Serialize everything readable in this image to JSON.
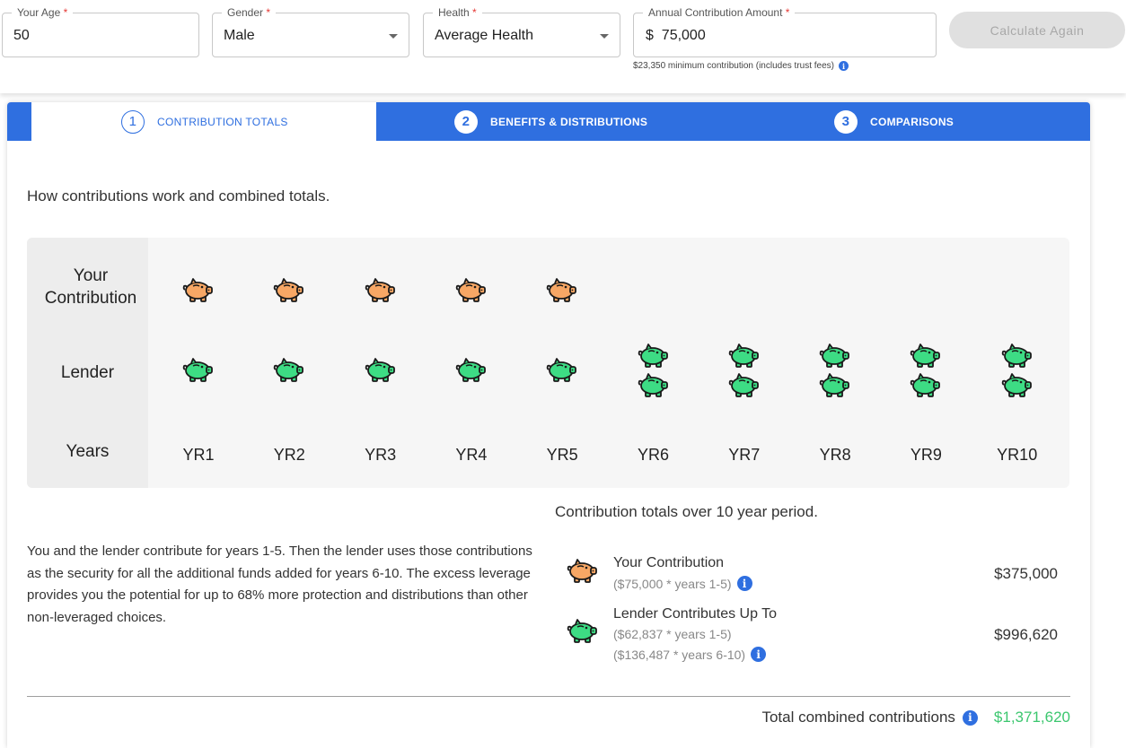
{
  "form": {
    "age": {
      "label": "Your Age",
      "required_mark": "*",
      "value": "50"
    },
    "gender": {
      "label": "Gender",
      "required_mark": "*",
      "value": "Male"
    },
    "health": {
      "label": "Health",
      "required_mark": "*",
      "value": "Average Health"
    },
    "amount": {
      "label": "Annual Contribution Amount",
      "required_mark": "*",
      "value": "$  75,000"
    },
    "hint": "$23,350 minimum contribution (includes trust fees)",
    "calculate_label": "Calculate Again"
  },
  "tabs": [
    {
      "num": "1",
      "label": "CONTRIBUTION TOTALS",
      "active": true
    },
    {
      "num": "2",
      "label": "BENEFITS & DISTRIBUTIONS",
      "active": false
    },
    {
      "num": "3",
      "label": "COMPARISONS",
      "active": false
    }
  ],
  "intro": "How contributions work and combined totals.",
  "grid": {
    "row_labels": {
      "yours": "Your Contribution",
      "lender": "Lender",
      "years": "Years"
    },
    "years": [
      "YR1",
      "YR2",
      "YR3",
      "YR4",
      "YR5",
      "YR6",
      "YR7",
      "YR8",
      "YR9",
      "YR10"
    ],
    "your_pigs_per_year": [
      1,
      1,
      1,
      1,
      1,
      0,
      0,
      0,
      0,
      0
    ],
    "lender_pigs_per_year": [
      1,
      1,
      1,
      1,
      1,
      2,
      2,
      2,
      2,
      2
    ]
  },
  "description": "You and the lender contribute for years 1-5. Then the lender uses those contributions as the security for all the additional funds added for years 6-10. The excess leverage provides you the potential for up to 68% more protection and distributions than other non-leveraged choices.",
  "totals": {
    "title": "Contribution totals over 10 year period.",
    "your": {
      "label": "Your Contribution",
      "sub1": "($75,000 * years 1-5)",
      "amount": "$375,000"
    },
    "lender": {
      "label": "Lender Contributes Up To",
      "sub1": "($62,837 * years 1-5)",
      "sub2": "($136,487 * years 6-10)",
      "amount": "$996,620"
    },
    "combined_label": "Total combined contributions",
    "combined_amount": "$1,371,620"
  },
  "colors": {
    "accent": "#2f6fe0",
    "orange_pig": "#f7a765",
    "green_pig": "#3ddc84",
    "total_green": "#3cc76f"
  },
  "icons": {
    "info": "i",
    "pig": "piggy-bank-icon",
    "caret": "chevron-down-icon"
  }
}
